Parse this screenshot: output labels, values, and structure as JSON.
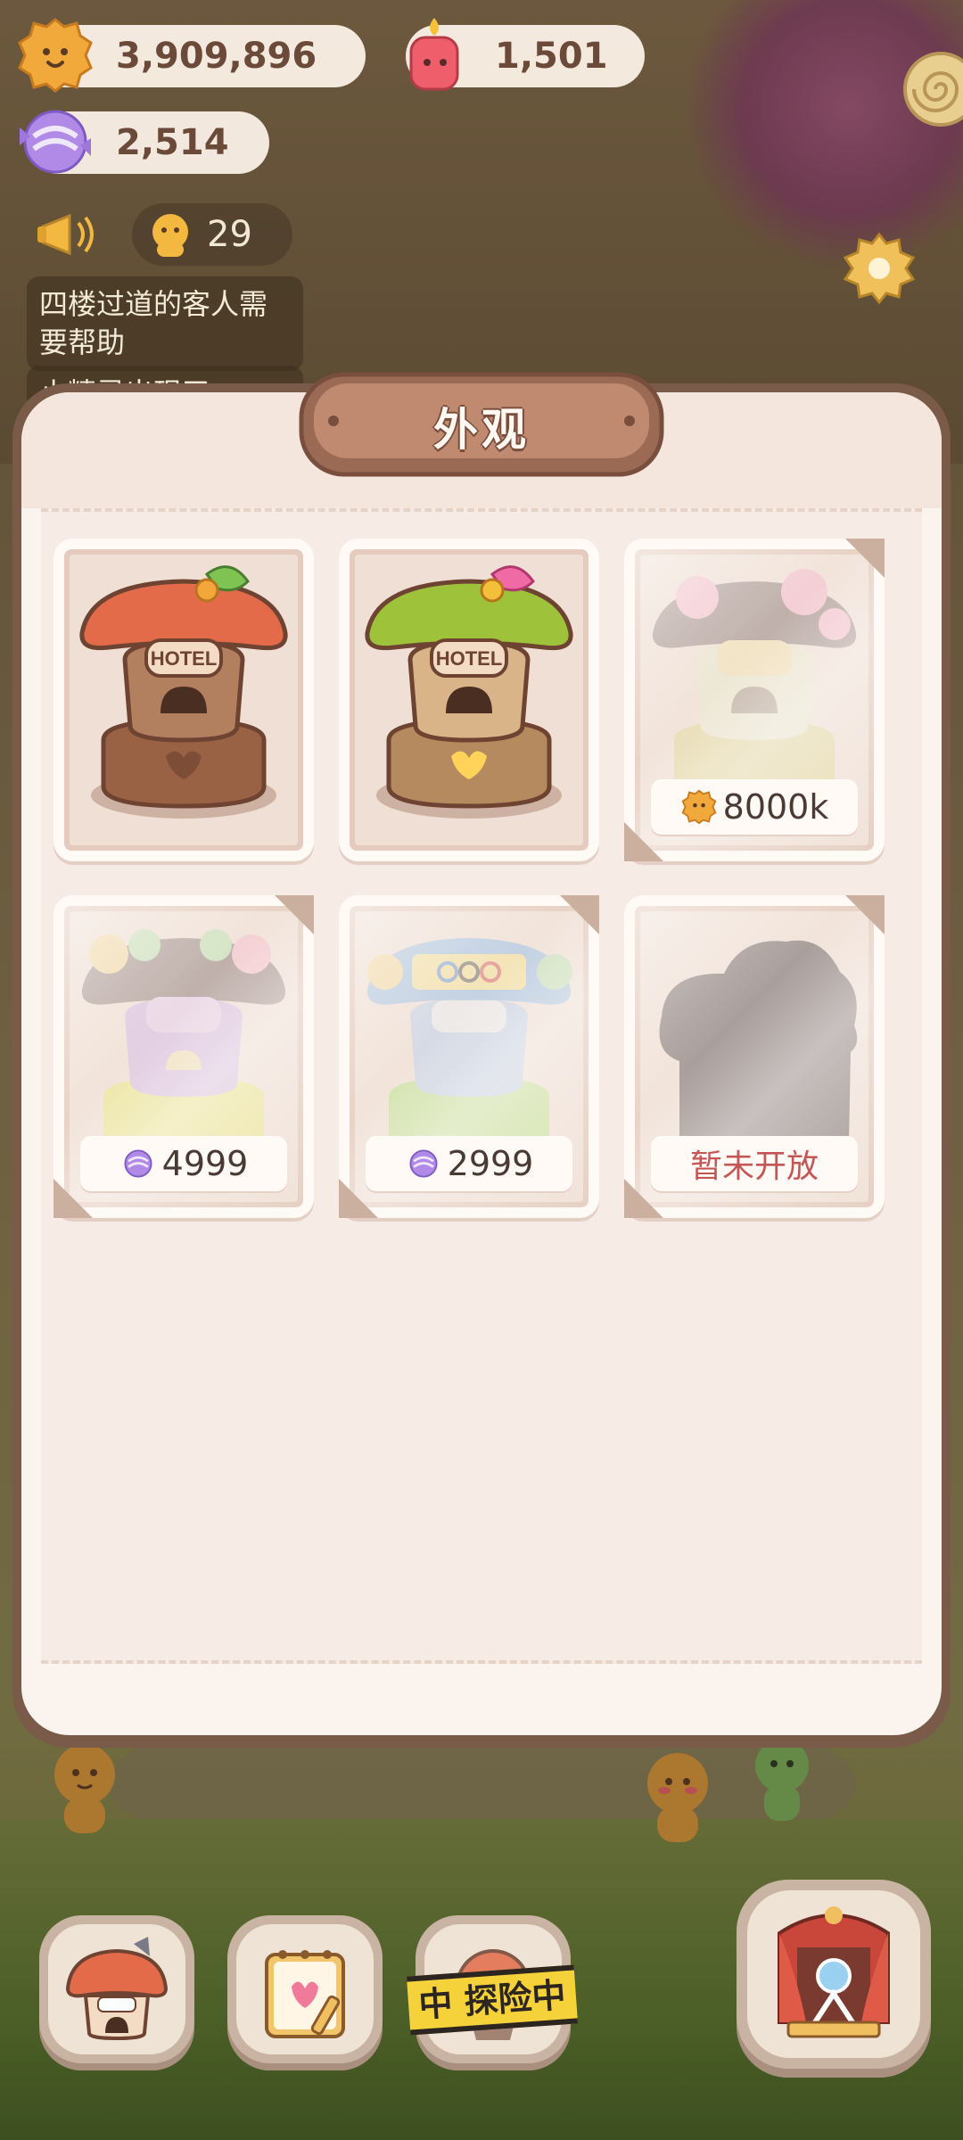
{
  "currencies": {
    "gold": "3,909,896",
    "candle": "1,501",
    "candy": "2,514"
  },
  "notices": {
    "count": "29",
    "message_1": "四楼过道的客人需要帮助",
    "message_2": "小精灵出现了"
  },
  "dialog": {
    "title": "外观"
  },
  "skins": [
    {
      "name": "orange-hotel",
      "price": ""
    },
    {
      "name": "green-hotel",
      "price": ""
    },
    {
      "name": "sakura-hotel",
      "price": "8000k",
      "currency_icon": "gold-coin-icon"
    },
    {
      "name": "balloon-hotel",
      "price": "4999",
      "currency_icon": "candy-icon"
    },
    {
      "name": "olympic-hotel",
      "price": "2999",
      "currency_icon": "candy-icon"
    },
    {
      "name": "locked-hotel",
      "price": "暂未开放"
    }
  ],
  "bottom_bar": {
    "explore_status": "中 探险中"
  },
  "colors": {
    "dialog_border": "#7a5a48",
    "dialog_bg": "#fbf3ee",
    "closed_text": "#c45656",
    "text": "#4a3a34"
  }
}
